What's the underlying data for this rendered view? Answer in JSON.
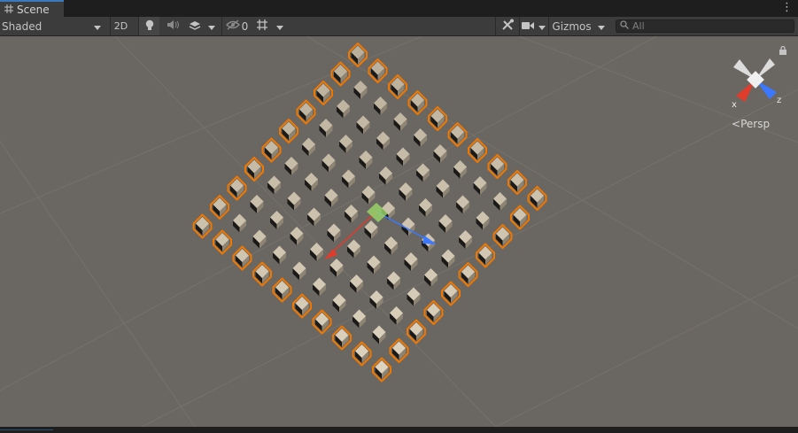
{
  "tab": {
    "label": "Scene",
    "icon": "grid-icon"
  },
  "toolbar": {
    "shading_mode": "Shaded",
    "mode_2d": "2D",
    "hidden_count": "0",
    "gizmos": "Gizmos",
    "search_placeholder": "All"
  },
  "gizmo": {
    "x_label": "x",
    "z_label": "z",
    "projection": "Persp"
  },
  "colors": {
    "viewport_bg": "#6a6661",
    "selection_outline": "#f07800",
    "axis_x": "#e03c2c",
    "axis_y": "#9bd96a",
    "axis_z": "#3b78ff"
  },
  "scene": {
    "grid_size": 10
  }
}
